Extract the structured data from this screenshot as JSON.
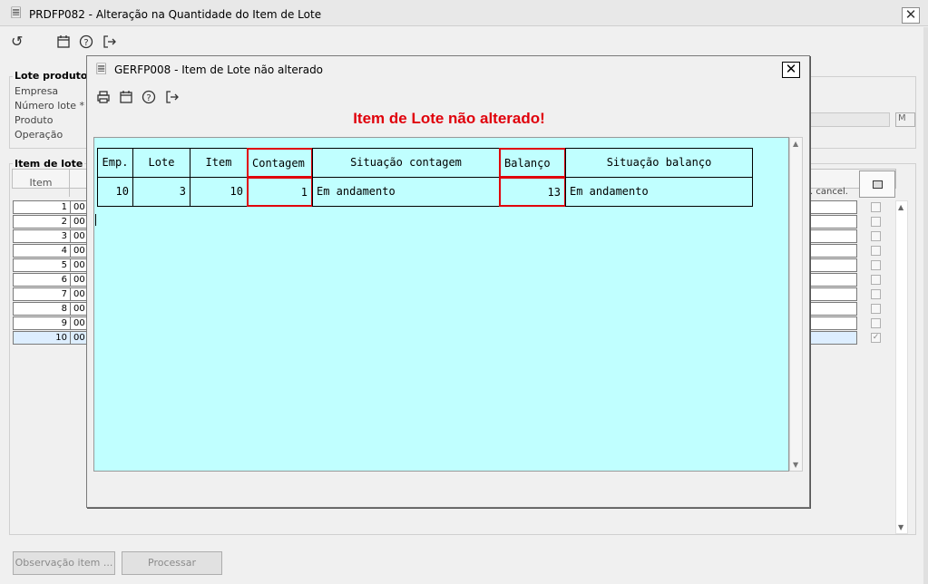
{
  "window": {
    "title": "PRDFP082 - Alteração na Quantidade do Item de Lote"
  },
  "lote_produto": {
    "label": "Lote produto",
    "fields": [
      "Empresa",
      "Número lote *",
      "Produto",
      "Operação"
    ],
    "unit_box": "M"
  },
  "item_de_lote": {
    "label": "Item de lote",
    "header_item": "Item",
    "header_cancel": ". cancel.",
    "rows": [
      {
        "num": "1",
        "code": "00"
      },
      {
        "num": "2",
        "code": "00"
      },
      {
        "num": "3",
        "code": "00"
      },
      {
        "num": "4",
        "code": "00"
      },
      {
        "num": "5",
        "code": "00"
      },
      {
        "num": "6",
        "code": "00"
      },
      {
        "num": "7",
        "code": "00"
      },
      {
        "num": "8",
        "code": "00"
      },
      {
        "num": "9",
        "code": "00"
      },
      {
        "num": "10",
        "code": "00"
      }
    ]
  },
  "buttons": {
    "observacao": "Observação item ...",
    "processar": "Processar"
  },
  "modal": {
    "title": "GERFP008 - Item de Lote não alterado",
    "heading": "Item de Lote não alterado!",
    "heading_color": "#e0000b",
    "table_bg": "#c0ffff",
    "table": {
      "headers": [
        "Emp.",
        "Lote",
        "Item",
        "Contagem",
        "Situação contagem",
        "Balanço",
        "Situação balanço"
      ],
      "row": [
        "10",
        "3",
        "10",
        "1",
        "Em andamento",
        "13",
        "Em andamento"
      ]
    }
  },
  "icons": [
    "undo-icon",
    "calendar-icon",
    "help-icon",
    "exit-icon",
    "print-icon",
    "document-icon"
  ]
}
